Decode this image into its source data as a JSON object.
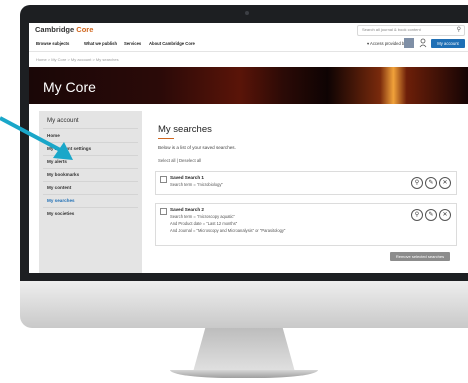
{
  "header": {
    "logo_part1": "Cambridge",
    "logo_part2": "Core",
    "search_placeholder": "Search all journal & book content",
    "account_button": "My account",
    "access_label": "Access provided by"
  },
  "nav": {
    "items": [
      "Browse subjects",
      "What we publish",
      "Services",
      "About Cambridge Core"
    ]
  },
  "breadcrumb": "Home  >  My Core  >  My account  >  My searches",
  "hero": {
    "title": "My Core"
  },
  "sidebar": {
    "heading": "My account",
    "items": [
      {
        "label": "Home",
        "active": false
      },
      {
        "label": "My account settings",
        "active": false
      },
      {
        "label": "My alerts",
        "active": false
      },
      {
        "label": "My bookmarks",
        "active": false
      },
      {
        "label": "My content",
        "active": false
      },
      {
        "label": "My searches",
        "active": true
      },
      {
        "label": "My societies",
        "active": false
      }
    ]
  },
  "main": {
    "title": "My searches",
    "description": "Below is a list of your saved searches.",
    "select_all": "Select all  |  Deselect all",
    "searches": [
      {
        "name": "Saved Search 1",
        "lines": [
          "Search term = \"microbiology\""
        ]
      },
      {
        "name": "Saved Search 2",
        "lines": [
          "Search term = \"microscopy aquatic\"",
          "And Product date = \"Last 12 months\"",
          "And Journal = \"Microscopy and Microanalysis\" or \"Parasitology\""
        ]
      }
    ],
    "remove_button": "Remove selected searches"
  },
  "colors": {
    "accent": "#1f6fb5",
    "brand_orange": "#d0661e",
    "arrow": "#1aa7c9",
    "sidebar_bg": "#e4e4e4"
  }
}
